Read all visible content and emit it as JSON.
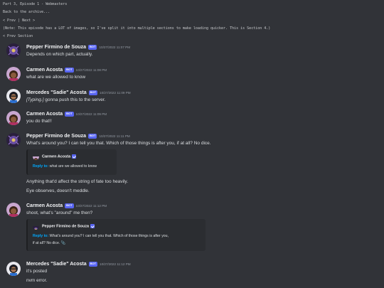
{
  "header": {
    "title": "Part 3, Episode 1 - Webmasters",
    "back_link": "Back to the archive...",
    "prev": "< Prev",
    "separator": "|",
    "next": "Next >",
    "note": "(Note: This episode has a LOT of images, so I've split it into multiple sections to make loading quicker. This is Section 4.)",
    "prev_section": "< Prev Section"
  },
  "messages": [
    {
      "username": "Pepper Firmino de Souza",
      "bot": "BOT",
      "timestamp": "10/27/2022 11:07 PM",
      "lines": [
        "Depends on which part, actually."
      ]
    },
    {
      "username": "Carmen Acosta",
      "bot": "BOT",
      "timestamp": "10/27/2022 11:08 PM",
      "lines": [
        "what are we allowed to know"
      ]
    },
    {
      "username": "Mercedes \"Sadie\" Acosta",
      "bot": "BOT",
      "timestamp": "10/27/2022 11:09 PM",
      "italic": "[Typing.]",
      "rest": " gonna push this to the server."
    },
    {
      "username": "Carmen Acosta",
      "bot": "BOT",
      "timestamp": "10/27/2022 11:09 PM",
      "lines": [
        "you do that!!"
      ]
    },
    {
      "username": "Pepper Firmino de Souza",
      "bot": "BOT",
      "timestamp": "10/27/2022 11:11 PM",
      "lines": [
        "What's around you? I can tell you that. Which of those things is after you, if at all? No dice."
      ],
      "embed": {
        "name": "Carmen Acosta",
        "reply_label": "Reply to:",
        "reply_text": " what are we allowed to know"
      },
      "after": [
        "Anything that'd affect the string of fate too heavily.",
        "Eye observes, doesn't meddle."
      ]
    },
    {
      "username": "Carmen Acosta",
      "bot": "BOT",
      "timestamp": "10/27/2022 11:12 PM",
      "lines": [
        "shoot, what's \"around\" me then?"
      ],
      "embed": {
        "name": "Pepper Firmino de Souza",
        "reply_label": "Reply to:",
        "reply_text": " What's around you? I can tell you that. Which of those things is after you,",
        "reply_text2": "if at all? No dice. 📎"
      }
    },
    {
      "username": "Mercedes \"Sadie\" Acosta",
      "bot": "BOT",
      "timestamp": "10/27/2022 11:12 PM",
      "lines": [
        "it's posted",
        "nvm error."
      ]
    }
  ]
}
